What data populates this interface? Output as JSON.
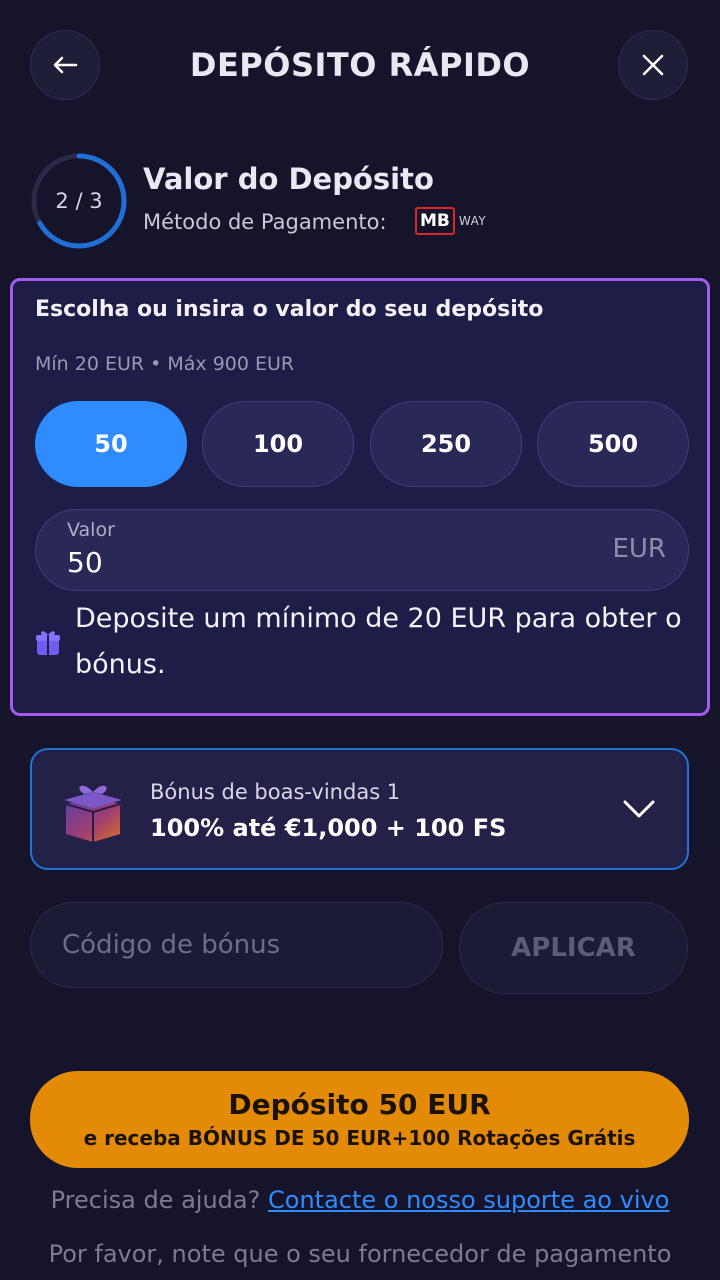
{
  "header": {
    "title": "DEPÓSITO RÁPIDO",
    "back_icon": "arrow-left-icon",
    "close_icon": "close-icon"
  },
  "step": {
    "indicator": "2 / 3",
    "progress": 0.667,
    "title": "Valor do Depósito",
    "method_label": "Método de Pagamento:",
    "method_logo": {
      "mb": "MB",
      "way": "WAY"
    }
  },
  "deposit": {
    "heading": "Escolha ou insira o valor do seu depósito",
    "limits": "Mín 20 EUR • Máx 900 EUR",
    "amounts": [
      "50",
      "100",
      "250",
      "500"
    ],
    "selected_amount": "50",
    "field_label": "Valor",
    "field_value": "50",
    "currency": "EUR",
    "bonus_note": "Deposite um mínimo de 20 EUR para obter o bónus."
  },
  "bonus": {
    "label": "Bónus de boas-vindas 1",
    "value": "100% até €1,000 + 100 FS"
  },
  "code": {
    "placeholder": "Código de bónus",
    "apply_label": "APLICAR"
  },
  "cta": {
    "main": "Depósito 50 EUR",
    "sub": "e receba BÓNUS DE 50 EUR+100 Rotações Grátis"
  },
  "footer": {
    "help_text": "Precisa de ajuda?",
    "help_link": "Contacte o nosso suporte ao vivo",
    "note": "Por favor, note que o seu fornecedor de pagamento"
  },
  "colors": {
    "background": "#15142b",
    "card": "#1e1d47",
    "card_border": "#a25cf0",
    "accent_blue": "#2f8cff",
    "cta_orange": "#e38b06"
  }
}
